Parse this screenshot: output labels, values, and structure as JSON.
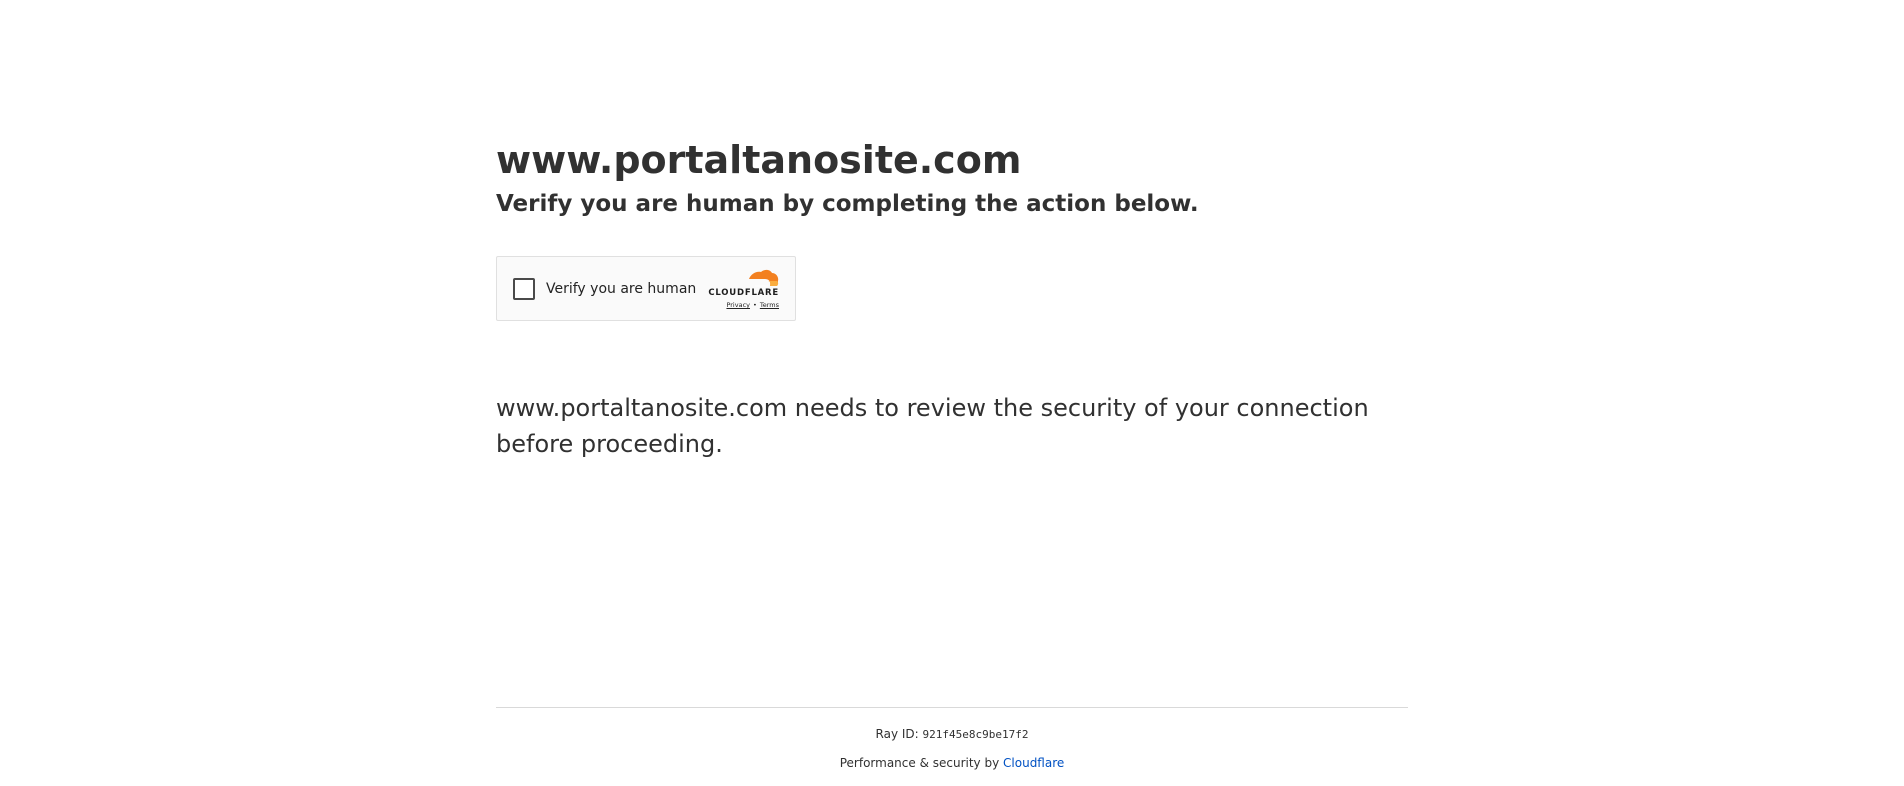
{
  "page": {
    "site_title": "www.portaltanosite.com",
    "subtitle": "Verify you are human by completing the action below.",
    "security_text": "www.portaltanosite.com needs to review the security of your connection before proceeding."
  },
  "widget": {
    "checkbox_label": "Verify you are human",
    "checked": false,
    "brand_name": "CLOUDFLARE",
    "privacy_label": "Privacy",
    "separator": "•",
    "terms_label": "Terms",
    "icon": "cloudflare-cloud-icon",
    "accent_color": "#f38020"
  },
  "footer": {
    "ray_label": "Ray ID:",
    "ray_id": "921f45e8c9be17f2",
    "perf_text": "Performance & security by",
    "perf_link": "Cloudflare",
    "link_color": "#0051c3"
  }
}
